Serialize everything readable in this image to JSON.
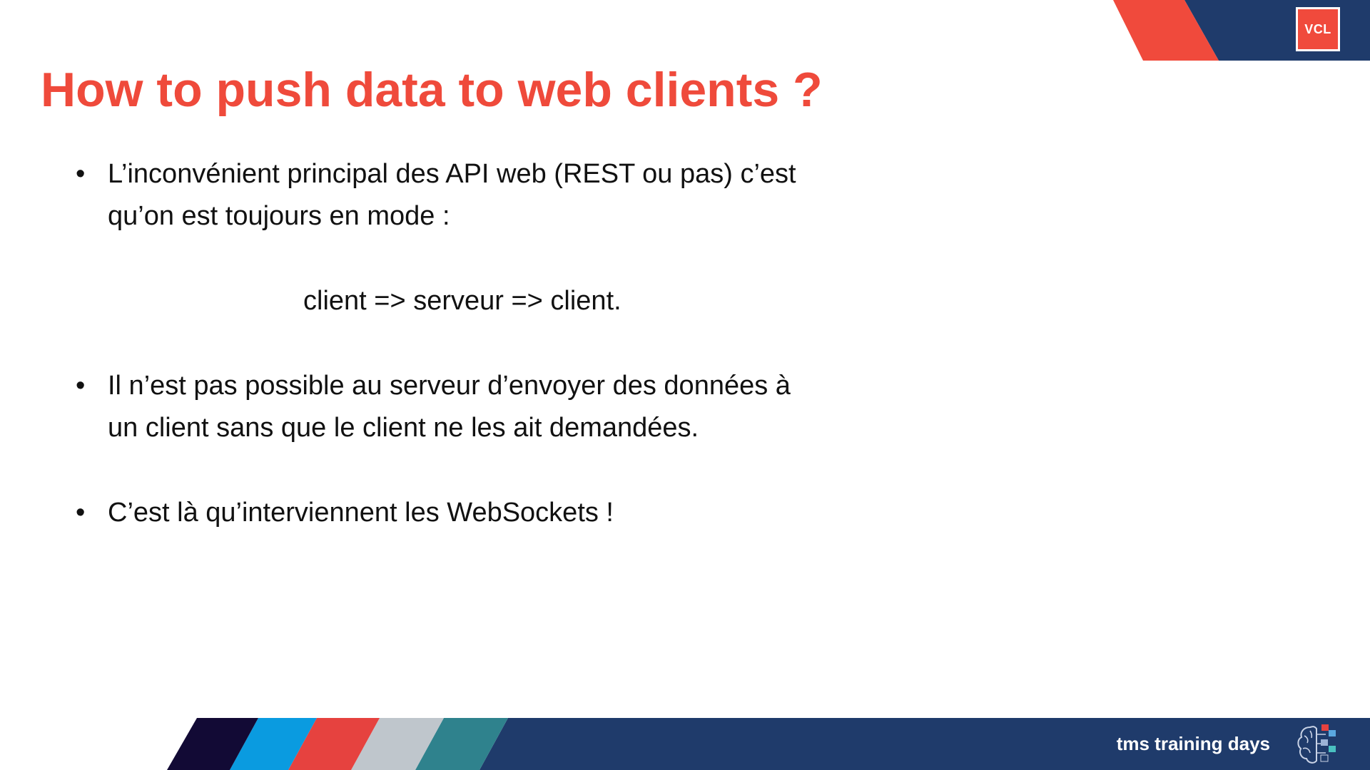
{
  "slide": {
    "title": "How to push data to web clients ?",
    "badge": "VCL",
    "bullet_glyph": "•",
    "bullets": [
      {
        "line1": "L’inconvénient principal des API web (REST ou pas) c’est",
        "line2": "qu’on est toujours en mode :"
      },
      {
        "line1": "Il n’est pas possible au serveur d’envoyer des données à",
        "line2": "un client sans que le client ne les ait demandées."
      },
      {
        "line1": "C’est là qu’interviennent les WebSockets !"
      }
    ],
    "centered_line": "client => serveur => client.",
    "footer_text": "tms training days"
  },
  "colors": {
    "title": "#ef4a3b",
    "navy": "#1f3b6b",
    "red": "#f04a3c",
    "dark_navy": "#120a35",
    "light_blue": "#0a9be0",
    "stripe_red": "#e6423f",
    "stripe_grey": "#bfc6cc",
    "stripe_teal": "#2f828d"
  },
  "icons": {
    "badge": "vcl-logo",
    "footer": "brain-icon"
  }
}
